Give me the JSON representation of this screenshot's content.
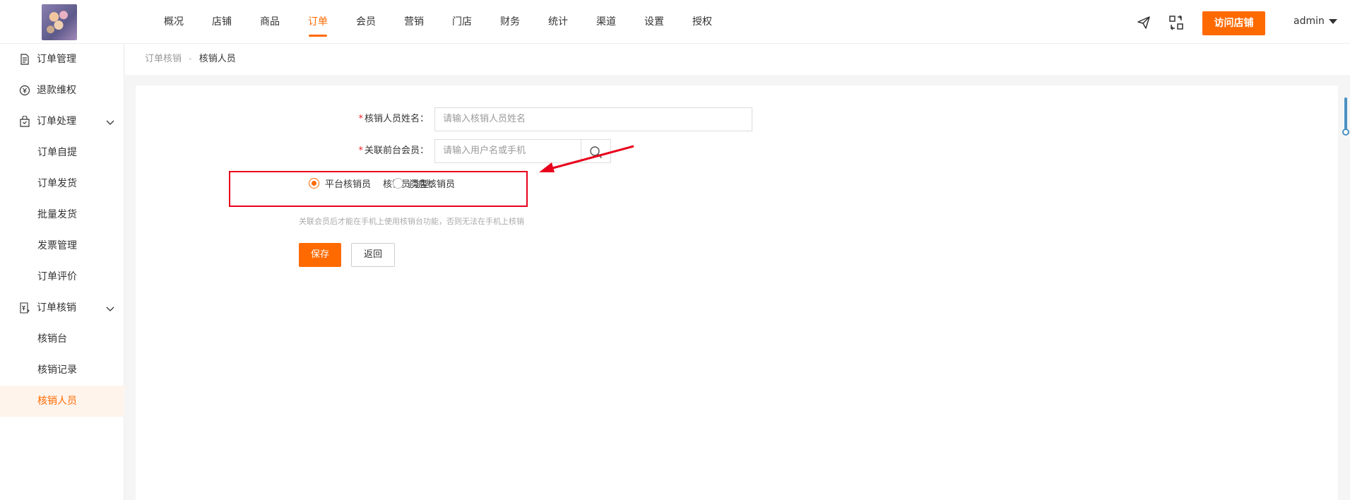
{
  "header": {
    "nav": [
      "概况",
      "店铺",
      "商品",
      "订单",
      "会员",
      "营销",
      "门店",
      "财务",
      "统计",
      "渠道",
      "设置",
      "授权"
    ],
    "active_nav": "订单",
    "visit_store_label": "访问店铺",
    "user_label": "admin",
    "icons": [
      "send-icon",
      "switch-icon"
    ],
    "accent_color": "#ff6a00"
  },
  "sidebar": {
    "items": [
      {
        "label": "订单管理",
        "icon": "document-icon"
      },
      {
        "label": "退款维权",
        "icon": "refund-icon"
      },
      {
        "label": "订单处理",
        "icon": "bag-icon",
        "expandable": true
      },
      {
        "label": "订单自提",
        "sub": true
      },
      {
        "label": "订单发货",
        "sub": true
      },
      {
        "label": "批量发货",
        "sub": true
      },
      {
        "label": "发票管理",
        "sub": true
      },
      {
        "label": "订单评价",
        "sub": true
      },
      {
        "label": "订单核销",
        "icon": "verify-icon",
        "expandable": true
      },
      {
        "label": "核销台",
        "sub": true
      },
      {
        "label": "核销记录",
        "sub": true
      },
      {
        "label": "核销人员",
        "sub": true,
        "active": true
      }
    ]
  },
  "breadcrumb": {
    "parent": "订单核销",
    "separator": "-",
    "current": "核销人员"
  },
  "form": {
    "name_label": "核销人员姓名：",
    "name_placeholder": "请输入核销人员姓名",
    "member_label": "关联前台会员：",
    "member_placeholder": "请输入用户名或手机",
    "type_label": "核销员类型：",
    "type_options": [
      "平台核销员",
      "门店核销员"
    ],
    "type_selected": "平台核销员",
    "hint": "关联会员后才能在手机上使用核销台功能，否则无法在手机上核销",
    "save_label": "保存",
    "back_label": "返回"
  }
}
